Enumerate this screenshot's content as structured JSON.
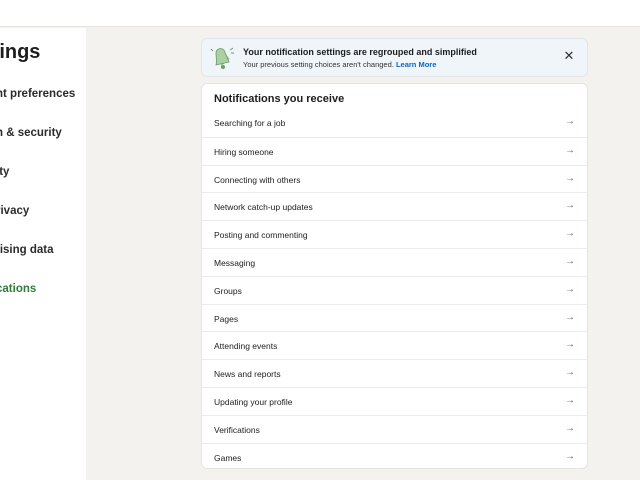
{
  "sidebar": {
    "title": "ttings",
    "items": [
      {
        "label": "nt preferences"
      },
      {
        "label": "n & security"
      },
      {
        "label": "ity"
      },
      {
        "label": "rivacy"
      },
      {
        "label": "tising data"
      },
      {
        "label": "cations"
      }
    ]
  },
  "banner": {
    "title": "Your notification settings are regrouped and simplified",
    "subtitle": "Your previous setting choices aren't changed.",
    "link": "Learn More",
    "close": "✕"
  },
  "card": {
    "title": "Notifications you receive",
    "arrow": "→",
    "rows": [
      {
        "label": "Searching for a job"
      },
      {
        "label": "Hiring someone"
      },
      {
        "label": "Connecting with others"
      },
      {
        "label": "Network catch-up updates"
      },
      {
        "label": "Posting and commenting"
      },
      {
        "label": "Messaging"
      },
      {
        "label": "Groups"
      },
      {
        "label": "Pages"
      },
      {
        "label": "Attending events"
      },
      {
        "label": "News and reports"
      },
      {
        "label": "Updating your profile"
      },
      {
        "label": "Verifications"
      },
      {
        "label": "Games"
      }
    ]
  },
  "colors": {
    "active": "#2e7d3a",
    "link": "#0a66c2",
    "background": "#f4f2ee"
  }
}
